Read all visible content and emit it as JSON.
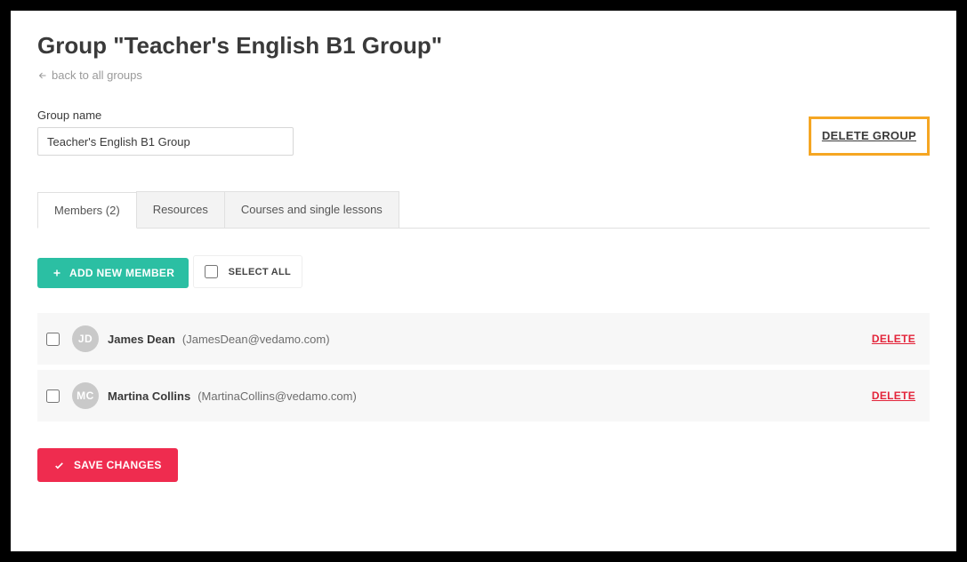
{
  "page_title": "Group \"Teacher's English B1 Group\"",
  "back_link": "back to all groups",
  "group_name_label": "Group name",
  "group_name_value": "Teacher's English B1 Group",
  "delete_group_label": "DELETE GROUP",
  "tabs": [
    {
      "label": "Members (2)",
      "selected": true
    },
    {
      "label": "Resources",
      "selected": false
    },
    {
      "label": "Courses and single lessons",
      "selected": false
    }
  ],
  "add_member_label": "ADD NEW MEMBER",
  "select_all_label": "SELECT ALL",
  "row_delete_label": "DELETE",
  "save_label": "SAVE CHANGES",
  "members": [
    {
      "initials": "JD",
      "name": "James Dean",
      "email": "(JamesDean@vedamo.com)"
    },
    {
      "initials": "MC",
      "name": "Martina Collins",
      "email": "(MartinaCollins@vedamo.com)"
    }
  ]
}
